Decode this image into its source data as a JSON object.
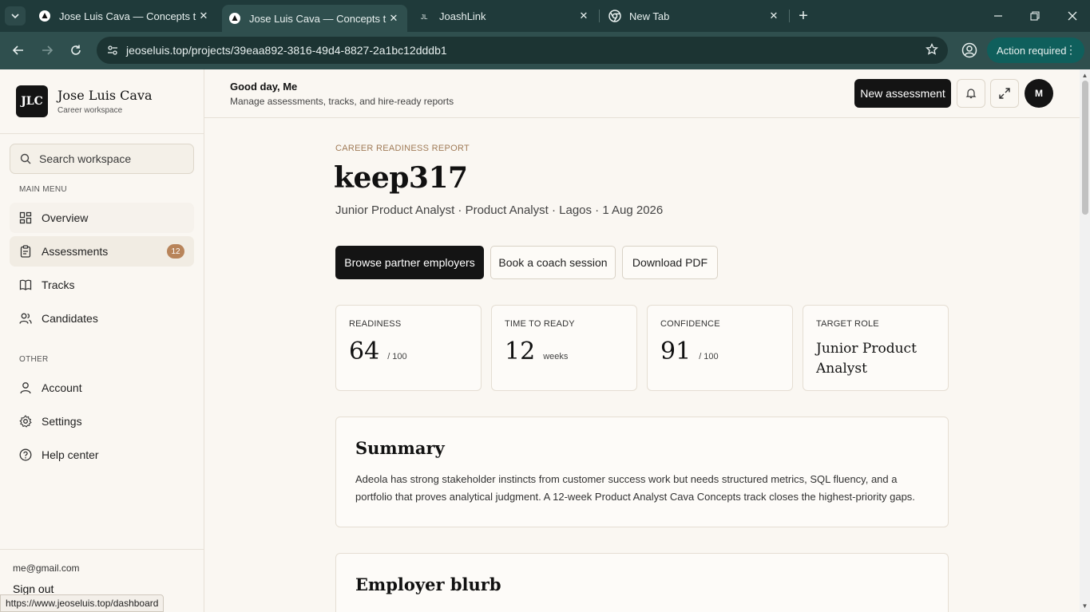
{
  "browser": {
    "tabs": [
      {
        "title": "Jose Luis Cava — Concepts that",
        "favicon": "triangle-icon"
      },
      {
        "title": "Jose Luis Cava — Concepts that",
        "favicon": "triangle-icon",
        "active": true
      },
      {
        "title": "JoashLink",
        "favicon": "jl-icon"
      },
      {
        "title": "New Tab",
        "favicon": "chrome-icon"
      }
    ],
    "url": "jeoseluis.top/projects/39eaa892-3816-49d4-8827-2a1bc12dddb1",
    "action_required": "Action required",
    "status_url": "https://www.jeoseluis.top/dashboard"
  },
  "sidebar": {
    "logo_text": "JLC",
    "brand_name": "Jose Luis Cava",
    "brand_sub": "Career workspace",
    "search_placeholder": "Search workspace",
    "main_heading": "MAIN MENU",
    "main_items": [
      {
        "label": "Overview",
        "icon": "grid-icon"
      },
      {
        "label": "Assessments",
        "icon": "clipboard-icon",
        "badge": "12",
        "active": true
      },
      {
        "label": "Tracks",
        "icon": "book-icon"
      },
      {
        "label": "Candidates",
        "icon": "users-icon"
      }
    ],
    "other_heading": "OTHER",
    "other_items": [
      {
        "label": "Account",
        "icon": "user-icon"
      },
      {
        "label": "Settings",
        "icon": "gear-icon"
      },
      {
        "label": "Help center",
        "icon": "help-icon"
      }
    ],
    "email": "me@gmail.com",
    "sign_out": "Sign out"
  },
  "header": {
    "greeting": "Good day, Me",
    "subtitle": "Manage assessments, tracks, and hire-ready reports",
    "new_assessment": "New assessment",
    "avatar_initial": "M"
  },
  "report": {
    "eyebrow": "CAREER READINESS REPORT",
    "title": "keep317",
    "meta": "Junior Product Analyst · Product Analyst · Lagos · 1 Aug 2026",
    "actions": {
      "browse": "Browse partner employers",
      "coach": "Book a coach session",
      "pdf": "Download PDF"
    },
    "stats": [
      {
        "label": "READINESS",
        "value": "64",
        "unit": "/ 100"
      },
      {
        "label": "TIME TO READY",
        "value": "12",
        "unit": "weeks"
      },
      {
        "label": "CONFIDENCE",
        "value": "91",
        "unit": "/ 100"
      },
      {
        "label": "TARGET ROLE",
        "value": "Junior Product Analyst"
      }
    ],
    "summary_title": "Summary",
    "summary_body": "Adeola has strong stakeholder instincts from customer success work but needs structured metrics, SQL fluency, and a portfolio that proves analytical judgment. A 12-week Product Analyst Cava Concepts track closes the highest-priority gaps.",
    "blurb_title": "Employer blurb"
  }
}
